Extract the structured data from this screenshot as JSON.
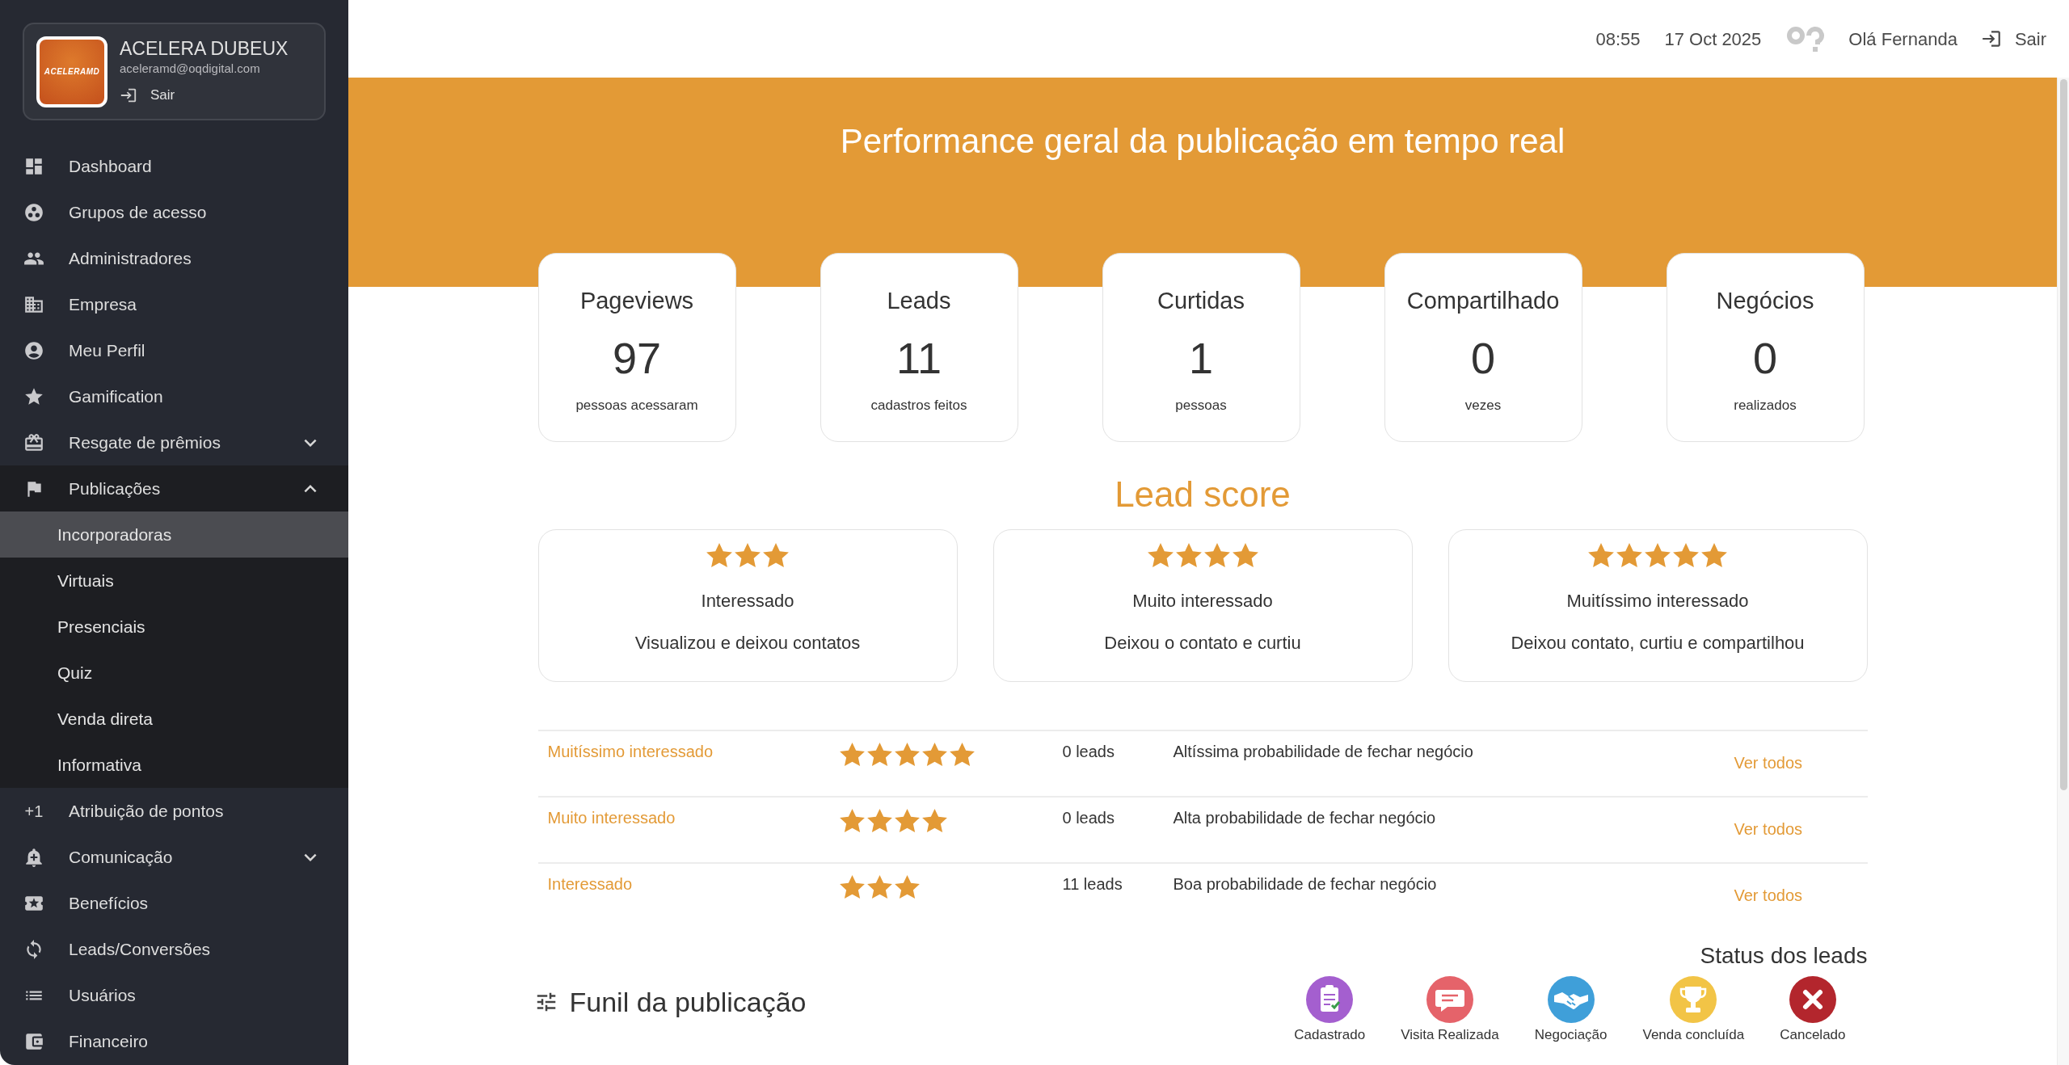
{
  "sidebar": {
    "profile": {
      "logo_text": "ACELERAMD",
      "name": "ACELERA DUBEUX",
      "email": "aceleramd@oqdigital.com",
      "logout": "Sair"
    },
    "items": [
      {
        "label": "Dashboard",
        "selected": false
      },
      {
        "label": "Grupos de acesso",
        "selected": false
      },
      {
        "label": "Administradores",
        "selected": false
      },
      {
        "label": "Empresa",
        "selected": false
      },
      {
        "label": "Meu Perfil",
        "selected": false
      },
      {
        "label": "Gamification",
        "selected": false
      },
      {
        "label": "Resgate de prêmios",
        "selected": false,
        "expanded": false
      },
      {
        "label": "Publicações",
        "selected": false,
        "expanded": true,
        "children": [
          {
            "label": "Incorporadoras",
            "selected": true
          },
          {
            "label": "Virtuais",
            "selected": false
          },
          {
            "label": "Presenciais",
            "selected": false
          },
          {
            "label": "Quiz",
            "selected": false
          },
          {
            "label": "Venda direta",
            "selected": false
          },
          {
            "label": "Informativa",
            "selected": false
          }
        ]
      },
      {
        "label": "Atribuição de pontos",
        "icon_text": "+1",
        "selected": false
      },
      {
        "label": "Comunicação",
        "selected": false,
        "expanded": false
      },
      {
        "label": "Benefícios",
        "selected": false
      },
      {
        "label": "Leads/Conversões",
        "selected": false
      },
      {
        "label": "Usuários",
        "selected": false
      },
      {
        "label": "Financeiro",
        "selected": false
      }
    ]
  },
  "top_bar": {
    "time": "08:55",
    "date": "17 Oct 2025",
    "greeting": "Olá Fernanda",
    "logout": "Sair"
  },
  "banner": {
    "title": "Performance geral da publicação em tempo real"
  },
  "stats": [
    {
      "title": "Pageviews",
      "value": "97",
      "caption": "pessoas acessaram"
    },
    {
      "title": "Leads",
      "value": "11",
      "caption": "cadastros feitos"
    },
    {
      "title": "Curtidas",
      "value": "1",
      "caption": "pessoas"
    },
    {
      "title": "Compartilhado",
      "value": "0",
      "caption": "vezes"
    },
    {
      "title": "Negócios",
      "value": "0",
      "caption": "realizados"
    }
  ],
  "lead_score": {
    "title": "Lead score",
    "cards": [
      {
        "stars": 3,
        "label": "Interessado",
        "description": "Visualizou e deixou contatos"
      },
      {
        "stars": 4,
        "label": "Muito interessado",
        "description": "Deixou o contato e curtiu"
      },
      {
        "stars": 5,
        "label": "Muitíssimo interessado",
        "description": "Deixou contato, curtiu e compartilhou"
      }
    ],
    "rows": [
      {
        "label": "Muitíssimo interessado",
        "stars": 5,
        "count": "0 leads",
        "description": "Altíssima probabilidade de fechar negócio",
        "link": "Ver todos"
      },
      {
        "label": "Muito interessado",
        "stars": 4,
        "count": "0 leads",
        "description": "Alta probabilidade de fechar negócio",
        "link": "Ver todos"
      },
      {
        "label": "Interessado",
        "stars": 3,
        "count": "11 leads",
        "description": "Boa probabilidade de fechar negócio",
        "link": "Ver todos"
      }
    ]
  },
  "funnel": {
    "title": "Funil da publicação"
  },
  "lead_status": {
    "title": "Status dos leads",
    "items": [
      {
        "label": "Cadastrado",
        "color": "#a45fcf"
      },
      {
        "label": "Visita Realizada",
        "color": "#e5636a"
      },
      {
        "label": "Negociação",
        "color": "#3f9fd9"
      },
      {
        "label": "Venda concluída",
        "color": "#f2c446"
      },
      {
        "label": "Cancelado",
        "color": "#b3262d"
      }
    ]
  }
}
